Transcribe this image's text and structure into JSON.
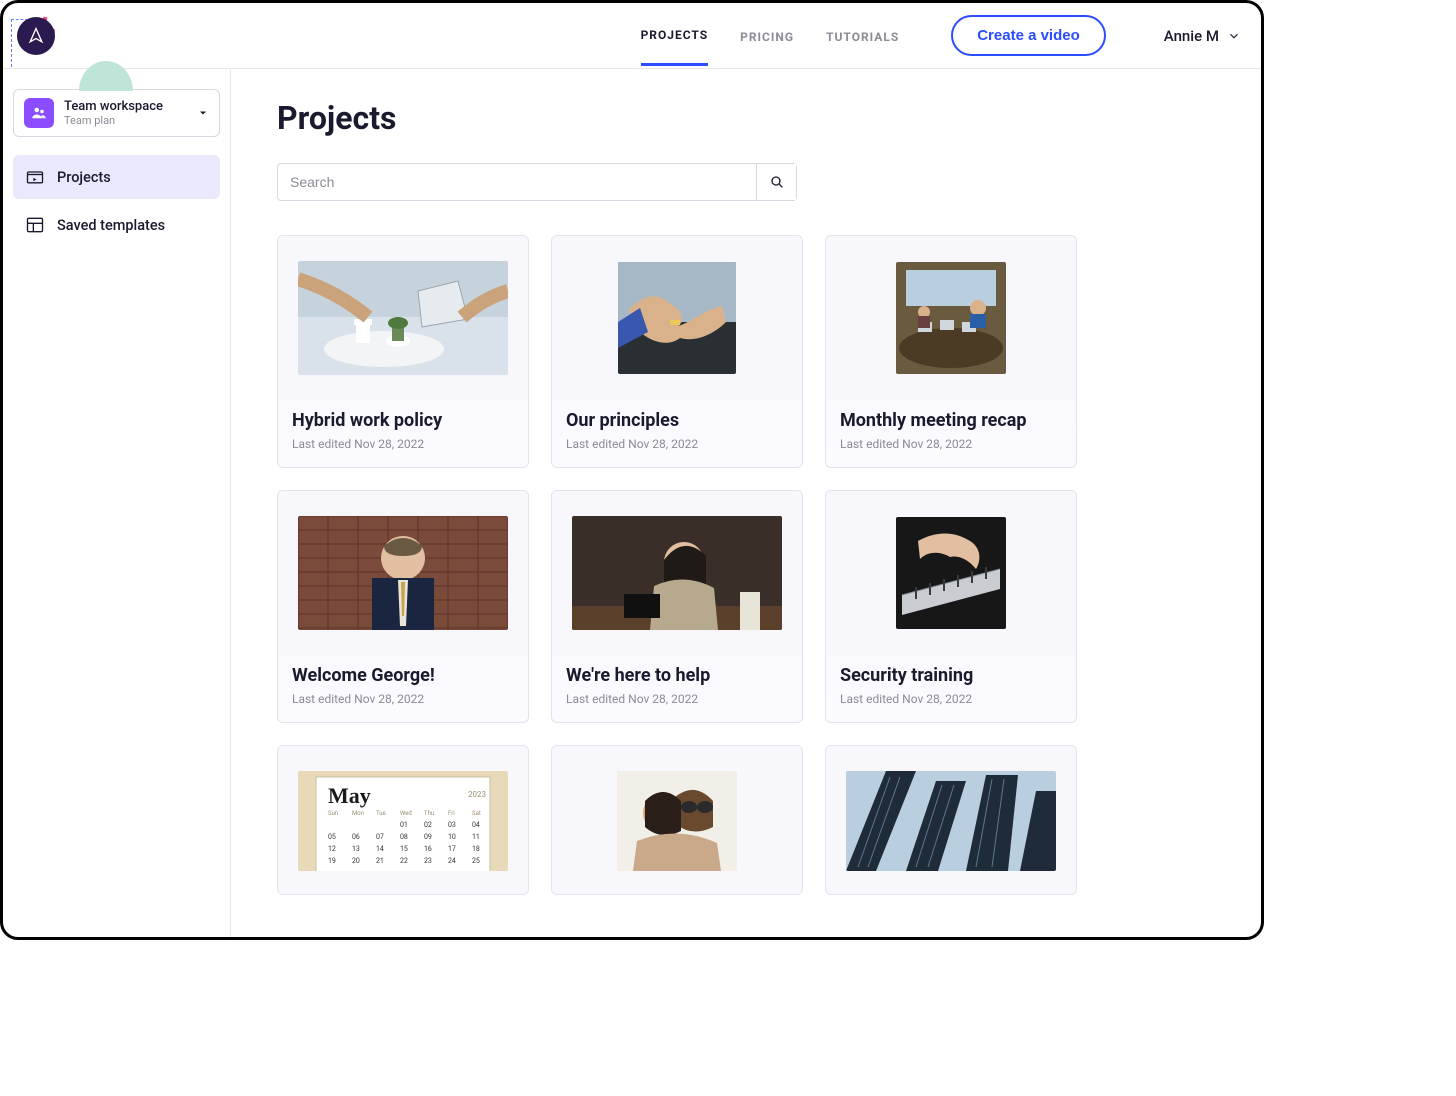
{
  "header": {
    "nav": {
      "projects": "PROJECTS",
      "pricing": "PRICING",
      "tutorials": "TUTORIALS"
    },
    "create_label": "Create a video",
    "user_name": "Annie M"
  },
  "sidebar": {
    "workspace": {
      "title": "Team workspace",
      "subtitle": "Team plan"
    },
    "items": [
      {
        "label": "Projects"
      },
      {
        "label": "Saved templates"
      }
    ]
  },
  "main": {
    "title": "Projects",
    "search_placeholder": "Search",
    "projects": [
      {
        "title": "Hybrid work policy",
        "date": "Last edited Nov 28, 2022"
      },
      {
        "title": "Our principles",
        "date": "Last edited Nov 28, 2022"
      },
      {
        "title": "Monthly meeting recap",
        "date": "Last edited Nov 28, 2022"
      },
      {
        "title": "Welcome George!",
        "date": "Last edited Nov 28, 2022"
      },
      {
        "title": "We're here to help",
        "date": "Last edited Nov 28, 2022"
      },
      {
        "title": "Security training",
        "date": "Last edited Nov 28, 2022"
      },
      {
        "title": "",
        "date": ""
      },
      {
        "title": "",
        "date": ""
      },
      {
        "title": "",
        "date": ""
      }
    ]
  }
}
